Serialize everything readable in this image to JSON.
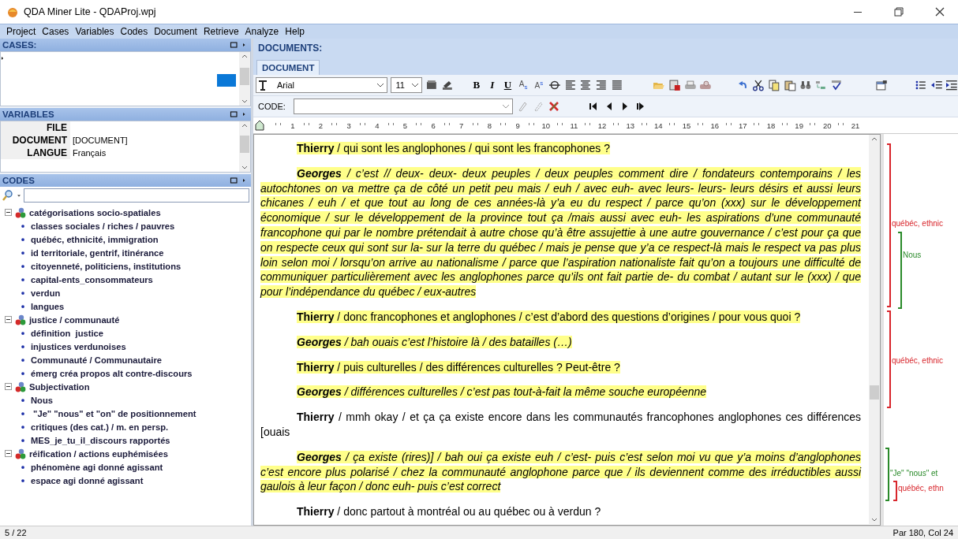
{
  "window": {
    "title": "QDA Miner Lite - QDAProj.wpj"
  },
  "menu": [
    "Project",
    "Cases",
    "Variables",
    "Codes",
    "Document",
    "Retrieve",
    "Analyze",
    "Help"
  ],
  "cases": {
    "title": "CASES:"
  },
  "variables": {
    "title": "VARIABLES",
    "rows": [
      {
        "name": "FILE"
      },
      {
        "name": "DOCUMENT",
        "value": "[DOCUMENT]"
      },
      {
        "name": "LANGUE",
        "value": "Français"
      }
    ]
  },
  "codes": {
    "title": "CODES",
    "tree": [
      {
        "label": "catégorisations socio-spatiales",
        "expanded": true,
        "children": [
          {
            "label": "classes sociales / riches / pauvres"
          },
          {
            "label": "québéc, ethnicité, immigration"
          },
          {
            "label": "id territoriale, gentrif, itinérance"
          },
          {
            "label": "citoyenneté, politiciens, institutions"
          },
          {
            "label": "capital-ents_consommateurs"
          },
          {
            "label": "verdun"
          },
          {
            "label": "langues"
          }
        ]
      },
      {
        "label": "justice / communauté",
        "expanded": true,
        "children": [
          {
            "label": "définition  justice"
          },
          {
            "label": "injustices verdunoises"
          },
          {
            "label": "Communauté / Communautaire"
          },
          {
            "label": "émerg créa propos alt contre-discours"
          }
        ]
      },
      {
        "label": "Subjectivation",
        "expanded": true,
        "children": [
          {
            "label": "Nous"
          },
          {
            "label": " \"Je\" \"nous\" et \"on\" de positionnement"
          },
          {
            "label": "critiques (des cat.) / m. en persp."
          },
          {
            "label": "MES_je_tu_il_discours rapportés"
          }
        ]
      },
      {
        "label": "réification / actions euphémisées",
        "expanded": true,
        "children": [
          {
            "label": "phénomène agi donné agissant"
          },
          {
            "label": "espace agi donné agissant"
          }
        ]
      }
    ]
  },
  "documents": {
    "title": "DOCUMENTS:",
    "tabs": [
      {
        "label": "DOCUMENT",
        "selected": true
      }
    ],
    "font": "Arial",
    "size": "11",
    "format_buttons": [
      {
        "label": "B",
        "kind": "bold"
      },
      {
        "label": "I",
        "kind": "italic"
      },
      {
        "label": "U",
        "kind": "underline"
      },
      {
        "label": "A$_{s}$",
        "kind": "script"
      },
      {
        "label": "A$^{s}$",
        "kind": "script"
      }
    ],
    "code_label": "CODE:",
    "ruler": [
      "1",
      "2",
      "3",
      "4",
      "5",
      "6",
      "7",
      "8",
      "9",
      "10",
      "11",
      "12",
      "13",
      "14",
      "15",
      "16",
      "17",
      "18",
      "19",
      "20",
      "21"
    ],
    "paragraphs": [
      {
        "speaker": "Thierry",
        "text": " / qui sont les anglophones / qui sont les francophones ?",
        "highlighted": true,
        "italic": false
      },
      {
        "speaker": "Georges",
        "text": " / c’est // deux- deux- deux peuples / deux peuples comment dire / fondateurs contemporains / les autochtones on va mettre ça de côté un petit peu mais / euh / avec euh- avec leurs- leurs- leurs désirs et aussi leurs chicanes / euh / et que tout au long de ces années-là y’a eu du respect / parce qu’on (xxx) sur le développement économique / sur le développement de la province tout ça /mais aussi avec euh- les aspirations d’une communauté francophone qui par le nombre prétendait à autre chose qu’à être assujettie à une autre gouvernance / c’est pour ça que on respecte ceux qui sont sur la- sur la terre du québec / mais je pense que y’a ce respect-là mais le respect va pas plus loin selon moi / lorsqu’on arrive au nationalisme / parce que l’aspiration nationaliste fait qu’on a toujours une difficulté de communiquer particulièrement avec les anglophones parce qu’ils ont fait partie de- du combat / autant sur le (xxx) / que pour l’indépendance du québec / eux-autres",
        "highlighted": true,
        "italic": true
      },
      {
        "speaker": "Thierry",
        "text": " / donc francophones et anglophones / c’est d’abord des questions d’origines / pour vous quoi ?",
        "highlighted": true,
        "italic": false
      },
      {
        "speaker": "Georges",
        "text": " / bah ouais c’est l’histoire là / des batailles (…)",
        "highlighted": true,
        "italic": true
      },
      {
        "speaker": "Thierry",
        "text": " / puis culturelles / des différences culturelles ? Peut-être ?",
        "highlighted": true,
        "italic": false
      },
      {
        "speaker": "Georges",
        "text": " / différences culturelles / c’est pas tout-à-fait la même souche européenne",
        "highlighted": true,
        "italic": true
      },
      {
        "speaker": "Thierry",
        "text": " / mmh okay / et ça ça existe encore dans les communautés francophones anglophones ces différences [ouais",
        "highlighted": false,
        "italic": false
      },
      {
        "speaker": "Georges",
        "text": " / ça existe (rires)] / bah oui ça existe euh / c’est- puis c’est selon moi vu que y’a moins d’anglophones c’est encore plus polarisé / chez la communauté anglophone parce que / ils deviennent comme des irréductibles aussi gaulois à leur façon / donc euh- puis c’est correct",
        "highlighted": true,
        "italic": true
      },
      {
        "speaker": "Thierry",
        "text": " / donc partout à montréal ou au québec ou à verdun ?",
        "highlighted": false,
        "italic": false
      }
    ],
    "margin_codes": [
      {
        "label": "québéc, ethnic",
        "color": "#d8262c"
      },
      {
        "label": "Nous",
        "color": "#2a8a2a"
      },
      {
        "label": "québéc, ethnic",
        "color": "#d8262c"
      },
      {
        "label": "\"Je\" \"nous\" et",
        "color": "#2a8a2a"
      },
      {
        "label": "québéc, ethn",
        "color": "#d8262c"
      }
    ]
  },
  "status_bar": {
    "left": "5 / 22",
    "right": "Par 180, Col 24"
  }
}
